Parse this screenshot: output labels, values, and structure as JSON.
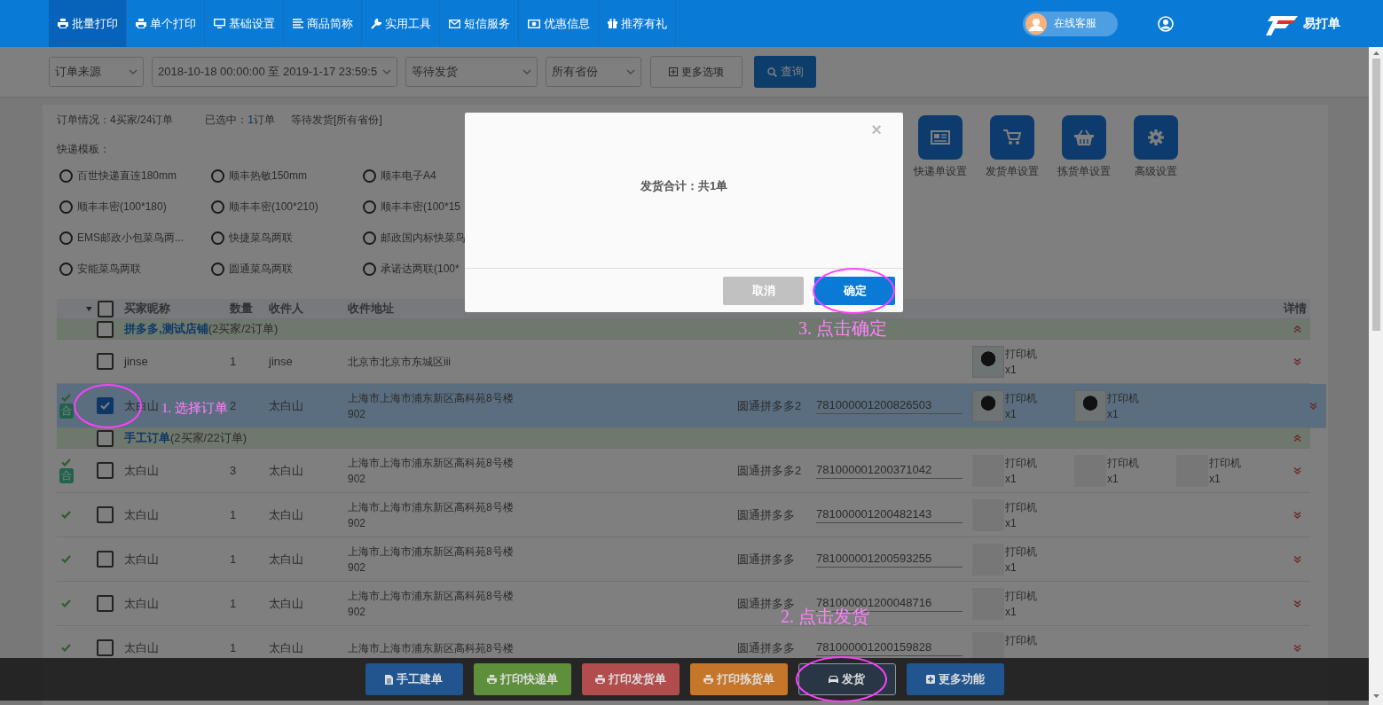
{
  "nav": {
    "items": [
      {
        "label": "批量打印",
        "selected": true
      },
      {
        "label": "单个打印",
        "selected": false
      },
      {
        "label": "基础设置",
        "selected": false
      },
      {
        "label": "商品简称",
        "selected": false
      },
      {
        "label": "实用工具",
        "selected": false
      },
      {
        "label": "短信服务",
        "selected": false
      },
      {
        "label": "优惠信息",
        "selected": false
      },
      {
        "label": "推荐有礼",
        "selected": false
      }
    ],
    "service": "在线客服",
    "logo": "易打单"
  },
  "filters": {
    "selects": [
      "订单来源",
      "2018-10-18 00:00:00 至 2019-1-17 23:59:5",
      "等待发货",
      "所有省份"
    ],
    "more": "更多选项",
    "query": "查询"
  },
  "summary": {
    "orders": "订单情况：4买家/24订单",
    "selected_label": "已选中：",
    "selected_count": "1",
    "selected_unit": "订单",
    "status": "等待发货[所有省份]"
  },
  "templates": {
    "label": "快递模板：",
    "options": [
      {
        "label": "百世快递直连180mm",
        "selected": false
      },
      {
        "label": "顺丰热敏150mm",
        "selected": false
      },
      {
        "label": "顺丰电子A4",
        "selected": false
      },
      {
        "label": "顺丰丰密(100*180)",
        "selected": false
      },
      {
        "label": "顺丰丰密(100*210)",
        "selected": false
      },
      {
        "label": "顺丰丰密(100*15",
        "selected": false
      },
      {
        "label": "EMS邮政小包菜鸟两...",
        "selected": false
      },
      {
        "label": "快捷菜鸟两联",
        "selected": false
      },
      {
        "label": "邮政国内标快菜鸟",
        "selected": false
      },
      {
        "label": "安能菜鸟两联",
        "selected": false
      },
      {
        "label": "圆通菜鸟两联",
        "selected": false
      },
      {
        "label": "承诺达两联(100*",
        "selected": false
      }
    ]
  },
  "settings": [
    "快递单设置",
    "发货单设置",
    "拣货单设置",
    "高级设置"
  ],
  "table": {
    "header_checked": false,
    "columns": [
      "买家昵称",
      "数量",
      "收件人",
      "收件地址",
      "详情"
    ],
    "groups": [
      {
        "name": "拼多多,测试店铺",
        "count": "(2买家/2订单)",
        "checked": false,
        "expanded": true,
        "rows": [
          {
            "buyer": "jinse",
            "qty": "1",
            "receiver": "jinse",
            "address_lines": [
              "北京市北京市东城区iii"
            ],
            "shipped": false,
            "checked": false,
            "selected": false,
            "expanded": false,
            "items": [
              {
                "name": "打印机",
                "qty": "x1",
                "kind": "photo"
              }
            ]
          },
          {
            "buyer": "太白山",
            "qty": "2",
            "receiver": "太白山",
            "address_lines": [
              "上海市上海市浦东新区高科苑8号楼",
              "902"
            ],
            "template": "圆通拼多多2",
            "tracking": "781000001200826503",
            "shipped": true,
            "badge": "合",
            "checked": true,
            "selected": true,
            "expanded": false,
            "items": [
              {
                "name": "打印机",
                "qty": "x1",
                "kind": "photo"
              },
              {
                "name": "打印机",
                "qty": "x1",
                "kind": "photo"
              }
            ]
          }
        ]
      },
      {
        "name": "手工订单",
        "count": "(2买家/22订单)",
        "checked": false,
        "expanded": true,
        "rows": [
          {
            "buyer": "太白山",
            "qty": "3",
            "receiver": "太白山",
            "address_lines": [
              "上海市上海市浦东新区高科苑8号楼",
              "902"
            ],
            "template": "圆通拼多多2",
            "tracking": "781000001200371042",
            "shipped": true,
            "badge": "合",
            "checked": false,
            "selected": false,
            "expanded": false,
            "items": [
              {
                "name": "打印机",
                "qty": "x1",
                "kind": "placeholder"
              },
              {
                "name": "打印机",
                "qty": "x1",
                "kind": "placeholder"
              },
              {
                "name": "打印机",
                "qty": "x1",
                "kind": "placeholder"
              }
            ]
          },
          {
            "buyer": "太白山",
            "qty": "1",
            "receiver": "太白山",
            "address_lines": [
              "上海市上海市浦东新区高科苑8号楼",
              "902"
            ],
            "template": "圆通拼多多",
            "tracking": "781000001200482143",
            "shipped": true,
            "checked": false,
            "selected": false,
            "expanded": false,
            "items": [
              {
                "name": "打印机",
                "qty": "x1",
                "kind": "placeholder"
              }
            ]
          },
          {
            "buyer": "太白山",
            "qty": "1",
            "receiver": "太白山",
            "address_lines": [
              "上海市上海市浦东新区高科苑8号楼",
              "902"
            ],
            "template": "圆通拼多多",
            "tracking": "781000001200593255",
            "shipped": true,
            "checked": false,
            "selected": false,
            "expanded": false,
            "items": [
              {
                "name": "打印机",
                "qty": "x1",
                "kind": "placeholder"
              }
            ]
          },
          {
            "buyer": "太白山",
            "qty": "1",
            "receiver": "太白山",
            "address_lines": [
              "上海市上海市浦东新区高科苑8号楼",
              "902"
            ],
            "template": "圆通拼多多",
            "tracking": "781000001200048716",
            "shipped": true,
            "checked": false,
            "selected": false,
            "expanded": false,
            "items": [
              {
                "name": "打印机",
                "qty": "x1",
                "kind": "placeholder"
              }
            ]
          },
          {
            "buyer": "太白山",
            "qty": "1",
            "receiver": "太白山",
            "address_lines": [
              "上海市上海市浦东新区高科苑8号楼"
            ],
            "template": "圆通拼多多",
            "tracking": "781000001200159828",
            "shipped": true,
            "checked": false,
            "selected": false,
            "expanded": false,
            "items": [
              {
                "name": "打印机",
                "kind": "placeholder"
              }
            ]
          }
        ]
      }
    ]
  },
  "actions": [
    {
      "label": "手工建单",
      "color": "#21558f"
    },
    {
      "label": "打印快递单",
      "color": "#5e8f3a"
    },
    {
      "label": "打印发货单",
      "color": "#b24d4d"
    },
    {
      "label": "打印拣货单",
      "color": "#c57628"
    },
    {
      "label": "发货",
      "color": "#283645"
    },
    {
      "label": "更多功能",
      "color": "#21558f"
    }
  ],
  "modal": {
    "close": "×",
    "message": "发货合计：共1单",
    "buttons": [
      {
        "label": "取消",
        "kind": "cancel"
      },
      {
        "label": "确定",
        "kind": "primary"
      }
    ]
  },
  "annotations": [
    "1. 选择订单",
    "2. 点击发货",
    "3. 点击确定"
  ]
}
